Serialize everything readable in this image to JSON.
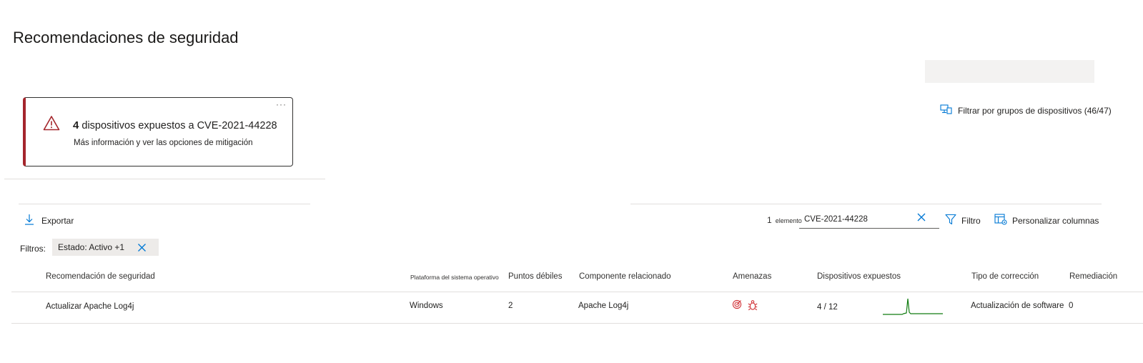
{
  "page": {
    "title": "Recomendaciones de seguridad"
  },
  "alert": {
    "more": "···",
    "count": "4",
    "headline": "dispositivos expuestos a CVE-2021-44228",
    "link": "Más información y ver las opciones de mitigación"
  },
  "device_groups": {
    "label": "Filtrar por grupos de dispositivos (46/47)"
  },
  "toolbar": {
    "export_label": "Exportar",
    "item_count": "1",
    "item_word": "elemento",
    "search_value": "CVE-2021-44228",
    "filter_label": "Filtro",
    "customize_label": "Personalizar columnas"
  },
  "filters": {
    "label": "Filtros:",
    "chip": "Estado: Activo +1"
  },
  "table": {
    "headers": {
      "recommendation": "Recomendación de seguridad",
      "os_platform": "Plataforma del sistema operativo",
      "weaknesses": "Puntos débiles",
      "component": "Componente relacionado",
      "threats": "Amenazas",
      "exposed": "Dispositivos expuestos",
      "remediation_type": "Tipo de corrección",
      "remediation": "Remediación"
    },
    "rows": [
      {
        "recommendation": "Actualizar Apache Log4j",
        "os_platform": "Windows",
        "weaknesses": "2",
        "component": "Apache Log4j",
        "threats": [
          "target-icon",
          "bug-icon"
        ],
        "exposed": "4 / 12",
        "remediation_type": "Actualización de software",
        "remediation": "0"
      }
    ]
  },
  "colors": {
    "accent": "#0078d4",
    "alert": "#a4262c",
    "threat": "#d13438",
    "sparkline": "#107c10"
  }
}
